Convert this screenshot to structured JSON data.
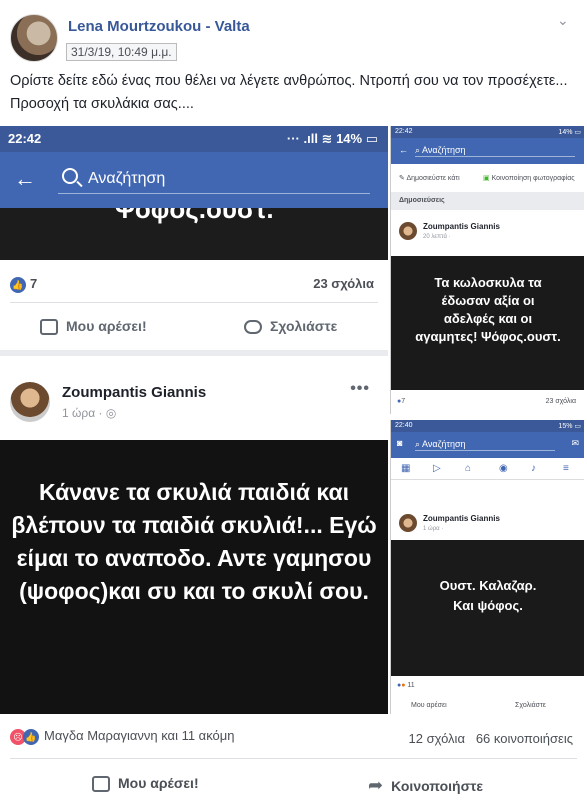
{
  "post": {
    "author": "Lena Mourtzoukou - Valta",
    "date": "31/3/19, 10:49 μ.μ.",
    "text": "Ορίστε δείτε εδώ ένας που θέλει να λέγετε ανθρώπος. Ντροπή σου να τον προσέχετε... Προσοχή τα σκυλάκια σας...."
  },
  "left_shot": {
    "time": "22:42",
    "status_right": "14%",
    "search_placeholder": "Αναζήτηση",
    "top_black_text": "Ψόφος.ουστ.",
    "likes": "7",
    "comments": "23 σχόλια",
    "like_label": "Μου αρέσει!",
    "comment_label": "Σχολιάστε",
    "author": "Zoumpantis Giannis",
    "time_ago": "1 ώρα ·",
    "dots": "•••",
    "image_text": "Κάνανε τα σκυλιά παιδιά και βλέπουν τα  παιδιά σκυλιά!... Εγώ είμαι το αναποδο. Αντε γαμησου (ψοφος)και συ και το σκυλί σου."
  },
  "right_shot_1": {
    "time": "22:42",
    "battery": "14%",
    "search": "Αναζήτηση",
    "action_post": "Δημοσιεύστε κάτι",
    "action_photo": "Κοινοποίηση φωτογραφίας",
    "section": "Δημοσιεύσεις",
    "author": "Zoumpantis Giannis",
    "time_ago": "20 λεπτά ·",
    "image_text": "Τα κωλοσκυλα τα έδωσαν αξία οι αδελφές και οι αγαμητες! Ψόφος.ουστ.",
    "likes": "7",
    "comments": "23 σχόλια"
  },
  "right_shot_2": {
    "time": "22:40",
    "battery": "15%",
    "search": "Αναζήτηση",
    "author": "Zoumpantis Giannis",
    "time_ago": "1 ώρα ·",
    "image_text": "Ουστ. Καλαζαρ. Και ψόφος.",
    "reactions": "11",
    "like_label": "Μου αρέσει",
    "comment_label": "Σχολιάστε"
  },
  "footer": {
    "reactors": "Μαγδα Μαραγιαννη και 11 ακόμη",
    "comments": "12 σχόλια",
    "shares": "66 κοινοποιήσεις",
    "like_button": "Μου αρέσει!",
    "share_button": "Κοινοποιήστε"
  },
  "colors": {
    "fb_blue": "#4267b2",
    "link": "#385898"
  }
}
